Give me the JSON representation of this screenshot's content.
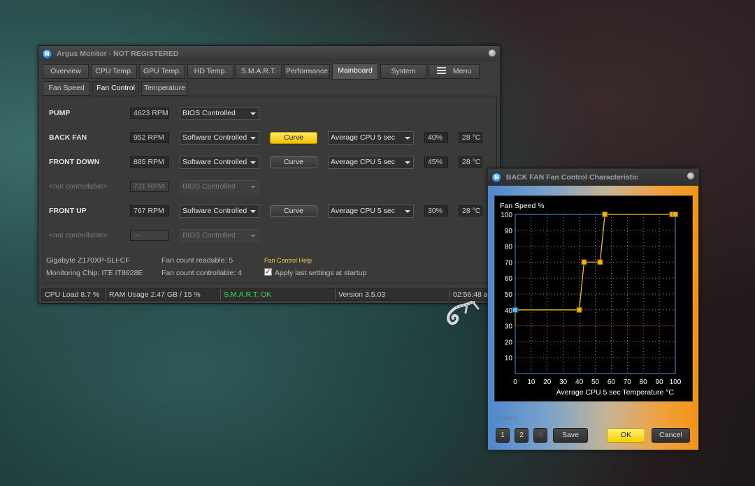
{
  "main": {
    "title": "Argus Monitor - NOT REGISTERED",
    "tabs": [
      {
        "label": "Overview"
      },
      {
        "label": "CPU Temp."
      },
      {
        "label": "GPU Temp."
      },
      {
        "label": "HD Temp."
      },
      {
        "label": "S.M.A.R.T."
      },
      {
        "label": "Performance"
      },
      {
        "label": "Mainboard"
      },
      {
        "label": "System"
      },
      {
        "label": "Menu"
      }
    ],
    "active_tab": "Mainboard",
    "subtabs": [
      {
        "label": "Fan Speed"
      },
      {
        "label": "Fan Control"
      },
      {
        "label": "Temperature"
      }
    ],
    "active_subtab": "Fan Control",
    "fans": [
      {
        "name": "PUMP",
        "rpm": "4623 RPM",
        "mode": "BIOS Controlled"
      },
      {
        "name": "BACK FAN",
        "rpm": "952 RPM",
        "mode": "Software Controlled",
        "curve": "Curve",
        "source": "Average CPU 5 sec",
        "percent": "40%",
        "temp": "28 °C"
      },
      {
        "name": "FRONT DOWN",
        "rpm": "885 RPM",
        "mode": "Software Controlled",
        "curve": "Curve",
        "source": "Average CPU 5 sec",
        "percent": "45%",
        "temp": "28 °C"
      },
      {
        "name": "<not controllable>",
        "rpm": "731 RPM",
        "mode": "BIOS Controlled"
      },
      {
        "name": "FRONT UP",
        "rpm": "767 RPM",
        "mode": "Software Controlled",
        "curve": "Curve",
        "source": "Average CPU 5 sec",
        "percent": "30%",
        "temp": "28 °C"
      },
      {
        "name": "<not controllable>",
        "rpm": "---",
        "mode": "BIOS Controlled"
      }
    ],
    "info": {
      "board": "Gigabyte Z170XP-SLI-CF",
      "chip": "Monitoring Chip: ITE IT8628E",
      "fan_readable": "Fan count readable: 5",
      "fan_controllable": "Fan count controllable: 4",
      "help_link": "Fan Control Help",
      "apply_label": "Apply last settings at startup",
      "apply_checked": true
    },
    "status": {
      "cpu_load": "CPU Load 8.7 %",
      "ram": "RAM Usage 2.47 GB / 15 %",
      "smart": "S.M.A.R.T. OK",
      "version": "Version 3.5.03",
      "time": "02:56:48 a"
    }
  },
  "dialog": {
    "title": "BACK FAN Fan Control Characteristic",
    "chart_data": {
      "type": "line",
      "ylabel": "Fan Speed %",
      "xlabel": "Average CPU 5 sec Temperature °C",
      "xlim": [
        0,
        100
      ],
      "ylim": [
        0,
        100
      ],
      "x_ticks": [
        0,
        10,
        20,
        30,
        40,
        50,
        60,
        70,
        80,
        90,
        100
      ],
      "y_ticks": [
        10,
        20,
        30,
        40,
        50,
        60,
        70,
        80,
        90,
        100
      ],
      "points": [
        {
          "x": 0,
          "y": 40
        },
        {
          "x": 40,
          "y": 40
        },
        {
          "x": 43,
          "y": 70
        },
        {
          "x": 53,
          "y": 70
        },
        {
          "x": 56,
          "y": 100
        },
        {
          "x": 98,
          "y": 100
        },
        {
          "x": 100,
          "y": 100
        }
      ],
      "current_point": {
        "x": 0,
        "y": 40
      },
      "reference_line_y": 30,
      "grid": true
    },
    "profiles_label": "Profiles",
    "profile_buttons": [
      "1",
      "2",
      "3"
    ],
    "save": "Save",
    "ok": "OK",
    "cancel": "Cancel"
  }
}
